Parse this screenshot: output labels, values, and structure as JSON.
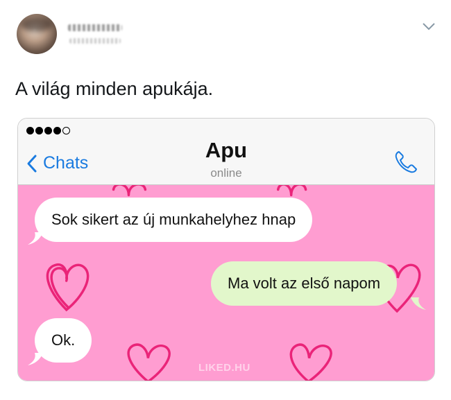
{
  "tweet": {
    "avatar_icon": "user-avatar",
    "name_redacted": true,
    "menu_icon": "chevron-down-icon",
    "text": "A világ minden apukája."
  },
  "phone": {
    "status_bar": {
      "signal_bars_filled": 4,
      "signal_bars_total": 5
    },
    "header": {
      "back_label": "Chats",
      "back_icon": "chevron-left-icon",
      "contact_name": "Apu",
      "contact_status": "online",
      "call_icon": "phone-icon",
      "accent_color": "#1a7be0"
    },
    "chat": {
      "background_color": "#ff9dd1",
      "messages": [
        {
          "direction": "incoming",
          "text": "Sok sikert az új munkahelyhez hnap"
        },
        {
          "direction": "outgoing",
          "text": "Ma volt az első napom"
        },
        {
          "direction": "incoming",
          "text": "Ok."
        }
      ],
      "watermark": "LIKED.HU"
    }
  }
}
